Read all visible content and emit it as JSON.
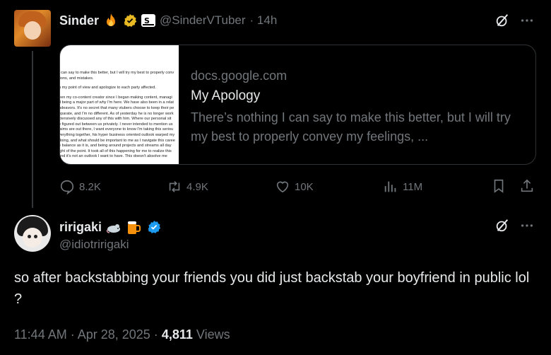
{
  "post": {
    "author_name": "Sinder",
    "author_handle": "@SinderVTuber",
    "time": "· 14h",
    "card": {
      "domain": "docs.google.com",
      "title": "My Apology",
      "description": "There’s nothing I can say to make this better, but I will try my best to properly convey my feelings, ...",
      "thumb_lines": [
        "I can say to make this better, but I will try my best to properly conv",
        "tions, and mistakes.",
        "",
        "n my point of view and apologize to each party affected.",
        "",
        "een my co-content creator since I began making content, managi",
        "d being a major part of why I'm here. We have also been in a relat",
        "ndeavors. It's no secret that many vtubers choose to keep their pe",
        "eparate, and I'm no different. As of yesterday he is no longer work",
        "xtensively discussed any of this with him. Where our personal sit",
        "e figured out between us privately. I never intended to mention us",
        "laims are out there, I want everyone to know I'm taking this seriou",
        "verything together, his hyper business oriented outlook warped my",
        "doing, and what should be important to me as I navigate this caree",
        "e balance as it is, and being around projects and streams all day",
        "ight of the point. It took all of this happening for me to realize this",
        "and it's not an outlook I want to have. This doesn't absolve me"
      ]
    },
    "stats": {
      "replies": "8.2K",
      "reposts": "4.9K",
      "likes": "10K",
      "views": "11M"
    }
  },
  "reply": {
    "author_name": "ririgaki",
    "author_handle": "@idiotririgaki",
    "text": "so after backstabbing your friends you did just backstab your boyfriend in public lol ?",
    "time": "11:44 AM · Apr 28, 2025 ·",
    "views_count": "4,811",
    "views_label": "Views"
  },
  "colors": {
    "verified_gold": "#e8b923",
    "verified_blue": "#1d9bf0",
    "muted": "#71767b",
    "text": "#e7e9ea"
  }
}
